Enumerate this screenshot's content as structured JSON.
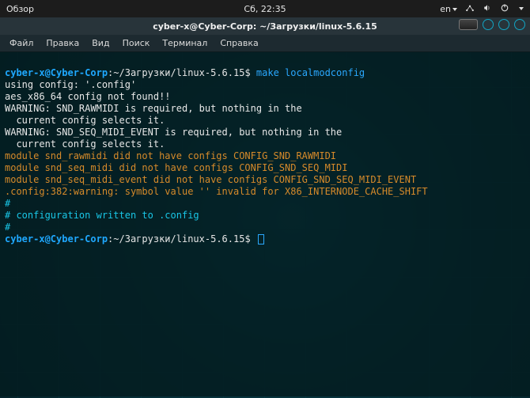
{
  "panel": {
    "activities": "Обзор",
    "clock": "Сб, 22:35",
    "lang": "en"
  },
  "window": {
    "title": "cyber-x@Cyber-Corp: ~/Загрузки/linux-5.6.15"
  },
  "menubar": {
    "file": "Файл",
    "edit": "Правка",
    "view": "Вид",
    "search": "Поиск",
    "terminal": "Терминал",
    "help": "Справка"
  },
  "term": {
    "prompt_user": "cyber-x@Cyber-Corp",
    "prompt_path": ":~/Загрузки/linux-5.6.15$ ",
    "cmd1": "make localmodconfig",
    "l1": "using config: '.config'",
    "l2": "aes_x86_64 config not found!!",
    "l3a": "WARNING: SND_RAWMIDI is required, but nothing in the",
    "l3b": "  current config selects it.",
    "l4a": "WARNING: SND_SEQ_MIDI_EVENT is required, but nothing in the",
    "l4b": "  current config selects it.",
    "l5": "module snd_rawmidi did not have configs CONFIG_SND_RAWMIDI",
    "l6": "module snd_seq_midi did not have configs CONFIG_SND_SEQ_MIDI",
    "l7": "module snd_seq_midi_event did not have configs CONFIG_SND_SEQ_MIDI_EVENT",
    "l8": ".config:382:warning: symbol value '' invalid for X86_INTERNODE_CACHE_SHIFT",
    "l9": "#",
    "l10": "# configuration written to .config",
    "l11": "#"
  }
}
